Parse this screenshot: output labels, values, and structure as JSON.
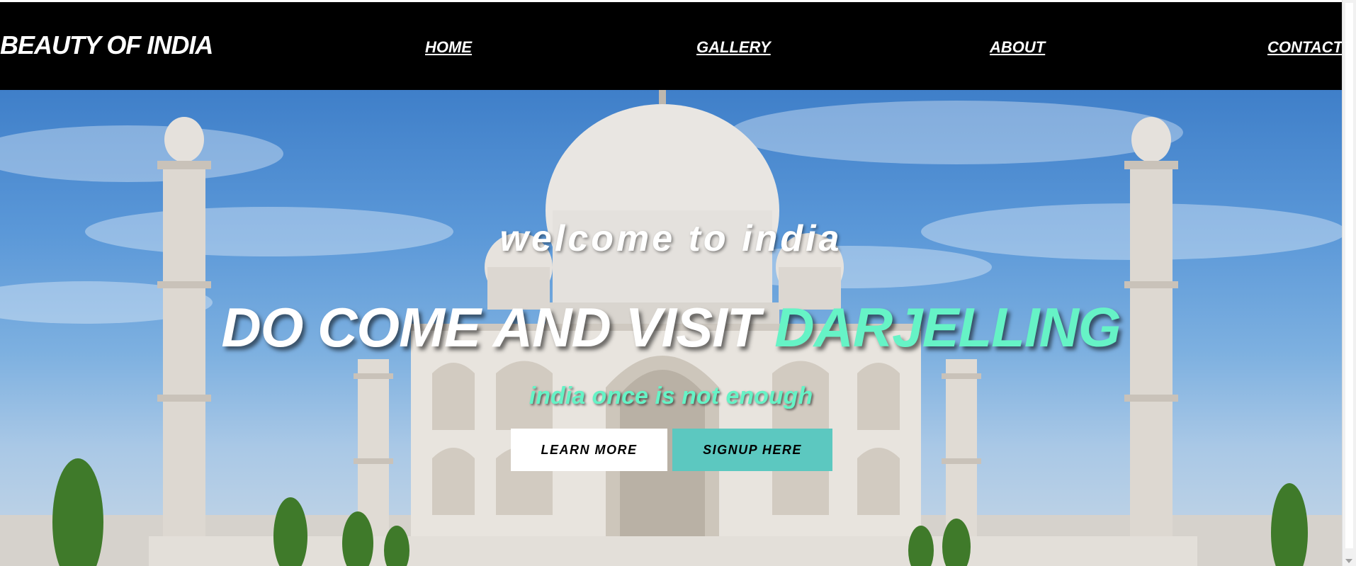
{
  "nav": {
    "brand": "BEAUTY OF INDIA",
    "links": [
      {
        "label": "HOME"
      },
      {
        "label": "GALLERY"
      },
      {
        "label": "ABOUT"
      },
      {
        "label": "CONTACT"
      }
    ]
  },
  "hero": {
    "welcome": "welcome to india",
    "headline_white": "DO COME AND VISIT ",
    "headline_accent": "DARJELLING",
    "tagline": "india once is not enough",
    "learn_more": "LEARN MORE",
    "signup": "SIGNUP HERE"
  },
  "colors": {
    "navbar_bg": "#000000",
    "accent": "#66f3c6",
    "signup_bg": "#5cc8c0"
  }
}
